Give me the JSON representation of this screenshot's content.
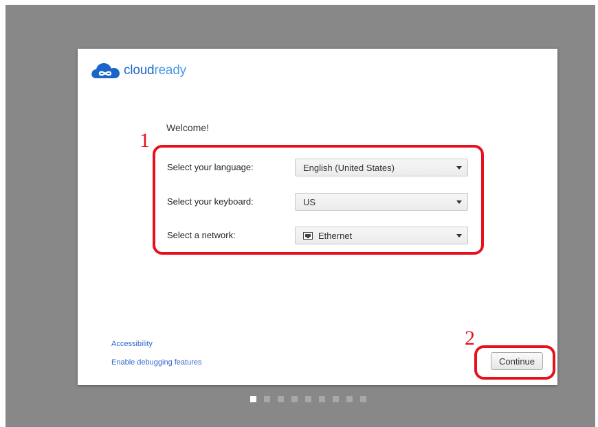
{
  "colors": {
    "backdrop": "#888888",
    "annotation": "#e8101c",
    "link": "#3366cc",
    "brand_dark": "#1a66c8",
    "brand_light": "#4b9be8"
  },
  "logo": {
    "icon": "cloud-infinity-icon",
    "text_bold": "cloud",
    "text_light": "ready"
  },
  "welcome": "Welcome!",
  "setup": {
    "language": {
      "label": "Select your language:",
      "value": "English (United States)"
    },
    "keyboard": {
      "label": "Select your keyboard:",
      "value": "US"
    },
    "network": {
      "label": "Select a network:",
      "value": "Ethernet",
      "icon": "ethernet-icon"
    }
  },
  "links": {
    "accessibility": "Accessibility",
    "debugging": "Enable debugging features"
  },
  "continue_label": "Continue",
  "annotations": {
    "one": "1",
    "two": "2"
  },
  "pager": {
    "total": 9,
    "current": 1
  }
}
